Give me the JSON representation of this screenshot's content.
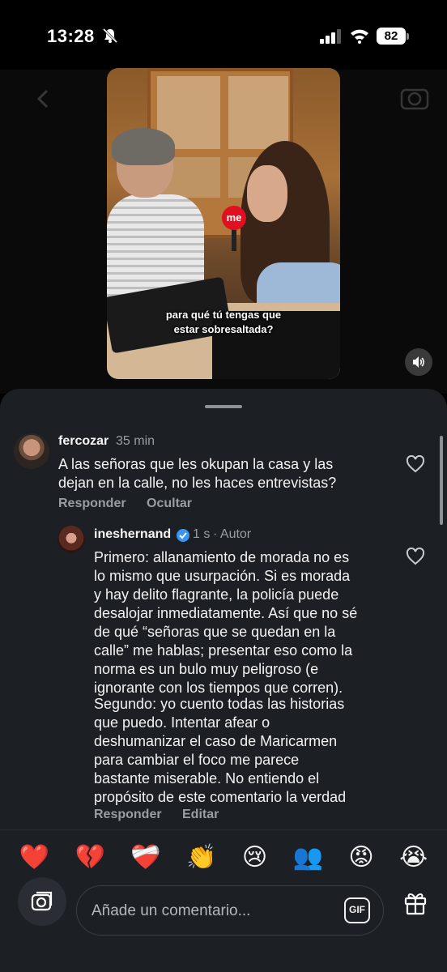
{
  "status_bar": {
    "time": "13:28",
    "battery": "82"
  },
  "video": {
    "subtitle_line1": "para qué tú tengas que",
    "subtitle_line2": "estar sobresaltada?",
    "mic_label": "me"
  },
  "comments": [
    {
      "username": "fercozar",
      "time": "35 min",
      "text_lines": [
        "A las señoras que les okupan la casa y las",
        "dejan en la calle, no les haces entrevistas?"
      ],
      "reply_label": "Responder",
      "hide_label": "Ocultar"
    },
    {
      "username": "ineshernand",
      "time": "1 s",
      "author_tag": "· Autor",
      "para1": [
        "Primero: allanamiento de morada no es",
        "lo mismo que usurpación. Si es morada",
        "y hay delito flagrante, la policía puede",
        "desalojar inmediatamente. Así que no sé",
        "de qué “señoras que se quedan en la",
        "calle” me hablas; presentar eso como la",
        "norma es un bulo muy peligroso (e",
        "ignorante con los tiempos que corren)."
      ],
      "para2": [
        "Segundo: yo cuento todas las historias",
        "que puedo. Intentar afear o",
        "deshumanizar el caso de Maricarmen",
        "para cambiar el foco me parece",
        "bastante miserable. No entiendo el",
        "propósito de este comentario la verdad"
      ],
      "reply_label": "Responder",
      "edit_label": "Editar"
    }
  ],
  "emojis": [
    "❤️",
    "💔",
    "❤️‍🩹",
    "👏",
    "😢",
    "👥",
    "😡",
    "😭"
  ],
  "composer": {
    "placeholder": "Añade un comentario...",
    "gif_label": "GIF"
  },
  "colors": {
    "sheet_bg": "#1c1f24",
    "verified": "#3797f0",
    "muted_text": "#9a9ea4"
  }
}
